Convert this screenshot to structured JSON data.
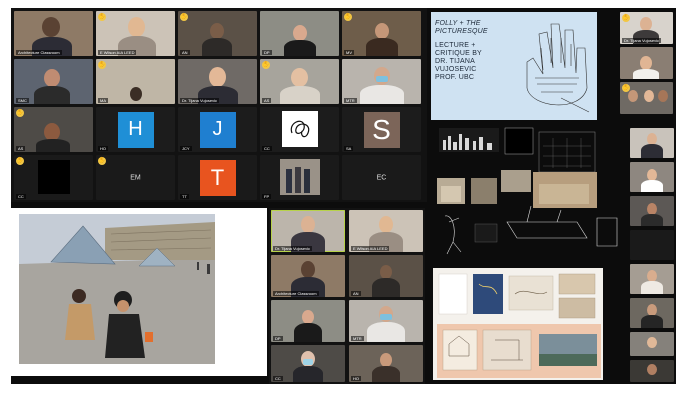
{
  "gallery_top": {
    "tiles": [
      {
        "name": "Architecture Classroom",
        "hand": false
      },
      {
        "name": "E Wilson AIA LEED",
        "hand": true
      },
      {
        "name": "AN",
        "hand": true
      },
      {
        "name": "DP",
        "hand": false
      },
      {
        "name": "MV",
        "hand": true
      },
      {
        "name": "SMC",
        "hand": false
      },
      {
        "name": "MA",
        "hand": true
      },
      {
        "name": "Dr. Tijana Vujosevic",
        "hand": false
      },
      {
        "name": "AS",
        "hand": true
      },
      {
        "name": "MTR",
        "hand": false
      },
      {
        "name": "AS",
        "hand": true
      },
      {
        "name": "HO",
        "hand": false,
        "initial": "H",
        "color": "#1f8fd6"
      },
      {
        "name": "JCY",
        "hand": false,
        "initial": "J",
        "color": "#1f7fd0"
      },
      {
        "name": "CC",
        "hand": false
      },
      {
        "name": "SA",
        "hand": false,
        "initial": "S",
        "color": "#7c6559"
      },
      {
        "name": "CC",
        "hand": true
      },
      {
        "name": "EM",
        "hand": true,
        "text": "EM"
      },
      {
        "name": "TT",
        "hand": false,
        "initial": "T",
        "color": "#e8541f"
      },
      {
        "name": "FP",
        "hand": false
      },
      {
        "name": "EC",
        "hand": false,
        "text": "EC"
      }
    ]
  },
  "poster": {
    "title": "FOLLY + THE PICTURESQUE",
    "subtitle": "LECTURE + CRITIQUE BY DR. TIJANA VUJOSEVIC PROF. UBC"
  },
  "sidebar_right_top": [
    {
      "name": "Dr. Tijana Vujosevic",
      "hand": true
    },
    {
      "name": "",
      "hand": false
    },
    {
      "name": "",
      "hand": true
    }
  ],
  "gallery_mid": {
    "tiles": [
      {
        "name": "Dr. Tijana Vujosevic",
        "speaking": true
      },
      {
        "name": "E Wilson AIA LEED"
      },
      {
        "name": "Architecture Classroom"
      },
      {
        "name": "AN"
      },
      {
        "name": "DP"
      },
      {
        "name": "MTR"
      },
      {
        "name": "CC"
      },
      {
        "name": "HO"
      }
    ]
  },
  "sidebar_right_bottom": [
    {
      "name": ""
    },
    {
      "name": ""
    },
    {
      "name": ""
    },
    {
      "name": ""
    },
    {
      "name": ""
    },
    {
      "name": ""
    },
    {
      "name": ""
    },
    {
      "name": ""
    },
    {
      "name": ""
    }
  ],
  "colors": {
    "background": "#0c0c0c",
    "hand_raise": "#f2c744",
    "speaking_border": "#b7d24a"
  }
}
